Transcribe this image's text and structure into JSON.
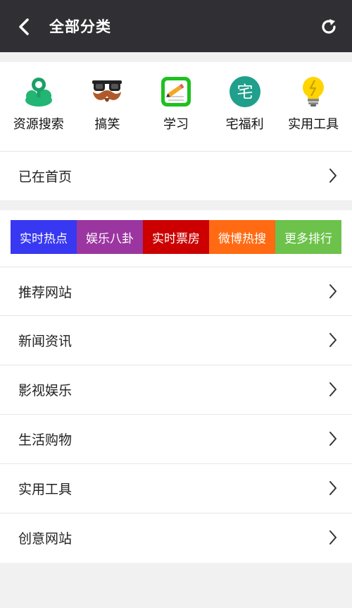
{
  "header": {
    "title": "全部分类",
    "back_icon": "chevron-left-icon",
    "refresh_icon": "refresh-icon"
  },
  "categories": [
    {
      "label": "资源搜索",
      "icon": "cloud-pin-icon"
    },
    {
      "label": "搞笑",
      "icon": "mustache-glasses-icon"
    },
    {
      "label": "学习",
      "icon": "pencil-note-icon"
    },
    {
      "label": "宅福利",
      "icon": "zhai-badge-icon",
      "glyph": "宅"
    },
    {
      "label": "实用工具",
      "icon": "lightbulb-icon"
    }
  ],
  "home_row": {
    "label": "已在首页"
  },
  "hot_tabs": [
    {
      "label": "实时热点",
      "color": "#3838f2"
    },
    {
      "label": "娱乐八卦",
      "color": "#9b35a0"
    },
    {
      "label": "实时票房",
      "color": "#cc0000"
    },
    {
      "label": "微博热搜",
      "color": "#ff6a12"
    },
    {
      "label": "更多排行",
      "color": "#6cc24a"
    }
  ],
  "list": [
    {
      "label": "推荐网站"
    },
    {
      "label": "新闻资讯"
    },
    {
      "label": "影视娱乐"
    },
    {
      "label": "生活购物"
    },
    {
      "label": "实用工具"
    },
    {
      "label": "创意网站"
    }
  ],
  "colors": {
    "header_bg": "#303034",
    "page_bg": "#f1f1f1",
    "card_bg": "#ffffff"
  }
}
